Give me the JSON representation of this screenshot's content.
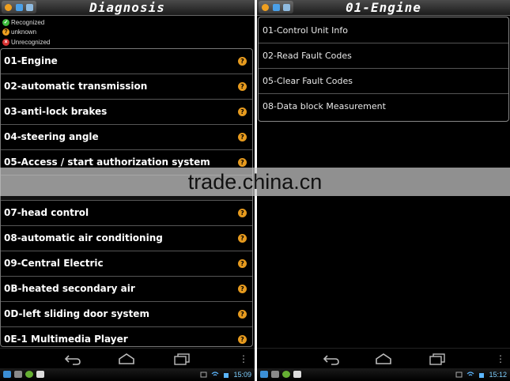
{
  "left_screen": {
    "title": "Diagnosis",
    "legend": [
      {
        "label": "Recognized",
        "icon": "check-circle-icon",
        "color": "#3dbb3d"
      },
      {
        "label": "unknown",
        "icon": "question-circle-icon",
        "color": "#f0a020"
      },
      {
        "label": "Unrecognized",
        "icon": "x-circle-icon",
        "color": "#d83030"
      }
    ],
    "modules": [
      {
        "label": "01-Engine",
        "status": "unknown"
      },
      {
        "label": "02-automatic transmission",
        "status": "unknown"
      },
      {
        "label": "03-anti-lock brakes",
        "status": "unknown"
      },
      {
        "label": "04-steering angle",
        "status": "unknown"
      },
      {
        "label": "05-Access / start authorization system",
        "status": "unknown"
      },
      {
        "label": "",
        "status": "hidden"
      },
      {
        "label": "07-head control",
        "status": "unknown"
      },
      {
        "label": "08-automatic air conditioning",
        "status": "unknown"
      },
      {
        "label": "09-Central Electric",
        "status": "unknown"
      },
      {
        "label": "0B-heated secondary air",
        "status": "unknown"
      },
      {
        "label": "0D-left sliding door system",
        "status": "unknown"
      },
      {
        "label": "0E-1 Multimedia Player",
        "status": "unknown"
      }
    ],
    "status_bar": {
      "time": "15:09"
    }
  },
  "right_screen": {
    "title": "01-Engine",
    "menu": [
      {
        "label": "01-Control Unit Info"
      },
      {
        "label": "02-Read Fault Codes"
      },
      {
        "label": "05-Clear Fault Codes"
      },
      {
        "label": "08-Data block Measurement"
      }
    ],
    "status_bar": {
      "time": "15:12"
    }
  },
  "icons": {
    "status_icon": "question-mark-icon",
    "nav": [
      "back-icon",
      "home-icon",
      "recent-apps-icon",
      "menu-overflow-icon"
    ]
  },
  "watermark": "trade.china.cn",
  "colors": {
    "background": "#000000",
    "unknown_badge": "#e69a1e",
    "clock": "#7fd0ff"
  }
}
